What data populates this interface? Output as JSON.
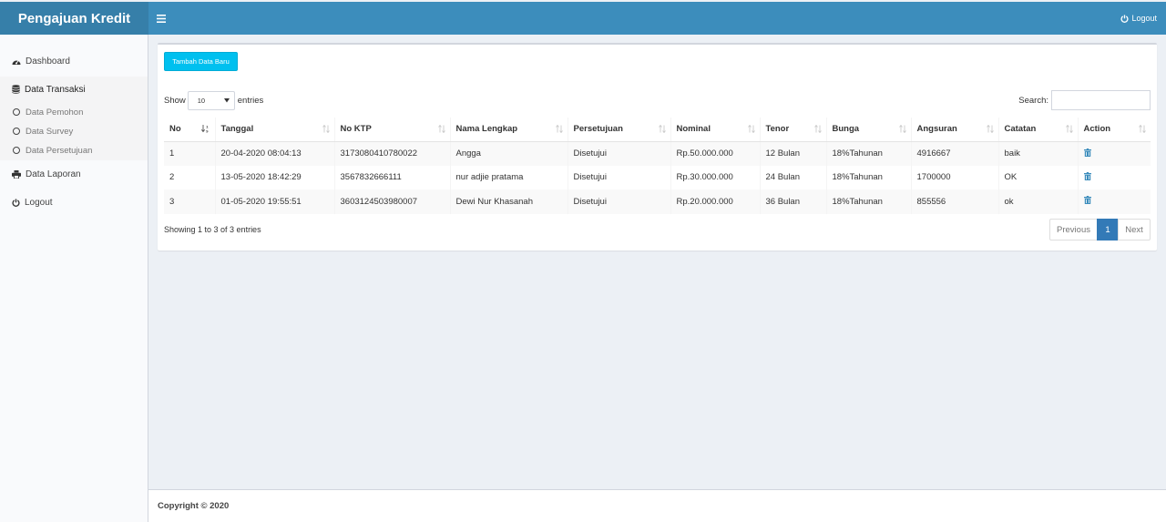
{
  "app": {
    "brand": "Pengajuan Kredit"
  },
  "header": {
    "logout_label": "Logout"
  },
  "sidebar": {
    "items": [
      {
        "label": "Dashboard",
        "icon": "dashboard-icon"
      },
      {
        "label": "Data Transaksi",
        "icon": "database-icon"
      },
      {
        "label": "Data Laporan",
        "icon": "print-icon"
      },
      {
        "label": "Logout",
        "icon": "power-icon"
      }
    ],
    "sub_items": [
      {
        "label": "Data Pemohon"
      },
      {
        "label": "Data Survey"
      },
      {
        "label": "Data Persetujuan"
      }
    ]
  },
  "main": {
    "add_button": "Tambah Data Baru",
    "show_label": "Show",
    "show_value": "10",
    "entries_label": "entries",
    "search_label": "Search:",
    "search_value": "",
    "columns": [
      "No",
      "Tanggal",
      "No KTP",
      "Nama Lengkap",
      "Persetujuan",
      "Nominal",
      "Tenor",
      "Bunga",
      "Angsuran",
      "Catatan",
      "Action"
    ],
    "rows": [
      [
        "1",
        "20-04-2020 08:04:13",
        "3173080410780022",
        "Angga",
        "Disetujui",
        "Rp.50.000.000",
        "12 Bulan",
        "18%Tahunan",
        "4916667",
        "baik"
      ],
      [
        "2",
        "13-05-2020 18:42:29",
        "3567832666111",
        "nur adjie pratama",
        "Disetujui",
        "Rp.30.000.000",
        "24 Bulan",
        "18%Tahunan",
        "1700000",
        "OK"
      ],
      [
        "3",
        "01-05-2020 19:55:51",
        "3603124503980007",
        "Dewi Nur Khasanah",
        "Disetujui",
        "Rp.20.000.000",
        "36 Bulan",
        "18%Tahunan",
        "855556",
        "ok"
      ]
    ],
    "info": "Showing 1 to 3 of 3 entries",
    "pagination": {
      "previous": "Previous",
      "current": "1",
      "next": "Next"
    }
  },
  "footer": {
    "copyright": "Copyright © 2020"
  },
  "colors": {
    "header": "#3c8dbc",
    "brand": "#367fa9",
    "button": "#00c0ef",
    "page_active": "#337ab7",
    "action_icon": "#3c8dbc"
  }
}
